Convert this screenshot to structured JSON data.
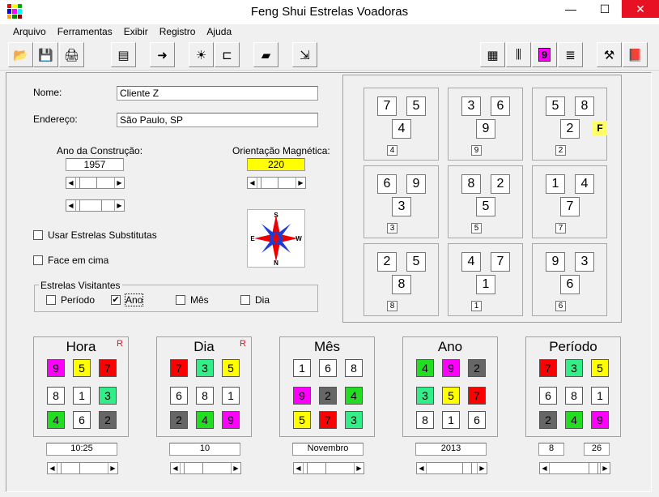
{
  "window": {
    "title": "Feng Shui Estrelas Voadoras",
    "minimize_glyph": "—",
    "maximize_glyph": "☐",
    "close_glyph": "✕"
  },
  "menu": [
    "Arquivo",
    "Ferramentas",
    "Exibir",
    "Registro",
    "Ajuda"
  ],
  "toolbar": [
    {
      "name": "open-icon",
      "glyph": "📂"
    },
    {
      "name": "save-icon",
      "glyph": "💾"
    },
    {
      "name": "print-icon",
      "glyph": "🖨"
    },
    {
      "name": "properties-icon",
      "glyph": "▤"
    },
    {
      "name": "arrow-right-icon",
      "glyph": "➜"
    },
    {
      "name": "lightbulb-icon",
      "glyph": "☀"
    },
    {
      "name": "layout-icon",
      "glyph": "⊏"
    },
    {
      "name": "book-icon",
      "glyph": "▰"
    },
    {
      "name": "export-icon",
      "glyph": "⇲"
    },
    {
      "name": "grid-chart-icon",
      "glyph": "▦"
    },
    {
      "name": "bars-icon",
      "glyph": "⫼"
    },
    {
      "name": "nine-icon",
      "glyph": "9"
    },
    {
      "name": "lines-icon",
      "glyph": "≣"
    },
    {
      "name": "tools-icon",
      "glyph": "⚒"
    },
    {
      "name": "help-book-icon",
      "glyph": "📕"
    }
  ],
  "form": {
    "name_label": "Nome:",
    "name_value": "Cliente  Z",
    "address_label": "Endereço:",
    "address_value": "São Paulo, SP",
    "year_label": "Ano da Construção:",
    "year_value": "1957",
    "orientation_label": "Orientação Magnética:",
    "orientation_value": "220",
    "substitute_label": "Usar Estrelas Substitutas",
    "face_label": "Face em cima",
    "visitors_label": "Estrelas Visitantes",
    "visitors": [
      {
        "label": "Período",
        "checked": false
      },
      {
        "label": "Ano",
        "checked": true
      },
      {
        "label": "Mês",
        "checked": false
      },
      {
        "label": "Dia",
        "checked": false
      }
    ]
  },
  "compass": {
    "n": "S",
    "s": "N",
    "w": "E",
    "e": "W"
  },
  "chart": {
    "palaces": [
      {
        "mountain": "7",
        "water": "5",
        "base": "4",
        "period": "4"
      },
      {
        "mountain": "3",
        "water": "6",
        "base": "9",
        "period": "9"
      },
      {
        "mountain": "5",
        "water": "8",
        "base": "2",
        "period": "2",
        "tag": "F"
      },
      {
        "mountain": "6",
        "water": "9",
        "base": "3",
        "period": "3"
      },
      {
        "mountain": "8",
        "water": "2",
        "base": "5",
        "period": "5"
      },
      {
        "mountain": "1",
        "water": "4",
        "base": "7",
        "period": "7"
      },
      {
        "mountain": "2",
        "water": "5",
        "base": "8",
        "period": "8"
      },
      {
        "mountain": "4",
        "water": "7",
        "base": "1",
        "period": "1"
      },
      {
        "mountain": "9",
        "water": "3",
        "base": "6",
        "period": "6"
      }
    ]
  },
  "colors": {
    "1": "#ffffff",
    "2": "#666666",
    "3": "#33ee88",
    "4": "#22dd22",
    "5": "#ffff00",
    "6": "#ffffff",
    "7": "#ff0000",
    "8": "#ffffff",
    "9": "#ff00ff"
  },
  "grids": [
    {
      "title": "Hora",
      "r": "R",
      "cells": [
        "9",
        "5",
        "7",
        "8",
        "1",
        "3",
        "4",
        "6",
        "2"
      ],
      "values": [
        "10:25"
      ]
    },
    {
      "title": "Dia",
      "r": "R",
      "cells": [
        "7",
        "3",
        "5",
        "6",
        "8",
        "1",
        "2",
        "4",
        "9"
      ],
      "values": [
        "10"
      ]
    },
    {
      "title": "Mês",
      "r": "",
      "cells": [
        "1",
        "6",
        "8",
        "9",
        "2",
        "4",
        "5",
        "7",
        "3"
      ],
      "values": [
        "Novembro"
      ]
    },
    {
      "title": "Ano",
      "r": "",
      "cells": [
        "4",
        "9",
        "2",
        "3",
        "5",
        "7",
        "8",
        "1",
        "6"
      ],
      "values": [
        "2013"
      ]
    },
    {
      "title": "Período",
      "r": "",
      "cells": [
        "7",
        "3",
        "5",
        "6",
        "8",
        "1",
        "2",
        "4",
        "9"
      ],
      "values": [
        "8",
        "26"
      ]
    }
  ]
}
